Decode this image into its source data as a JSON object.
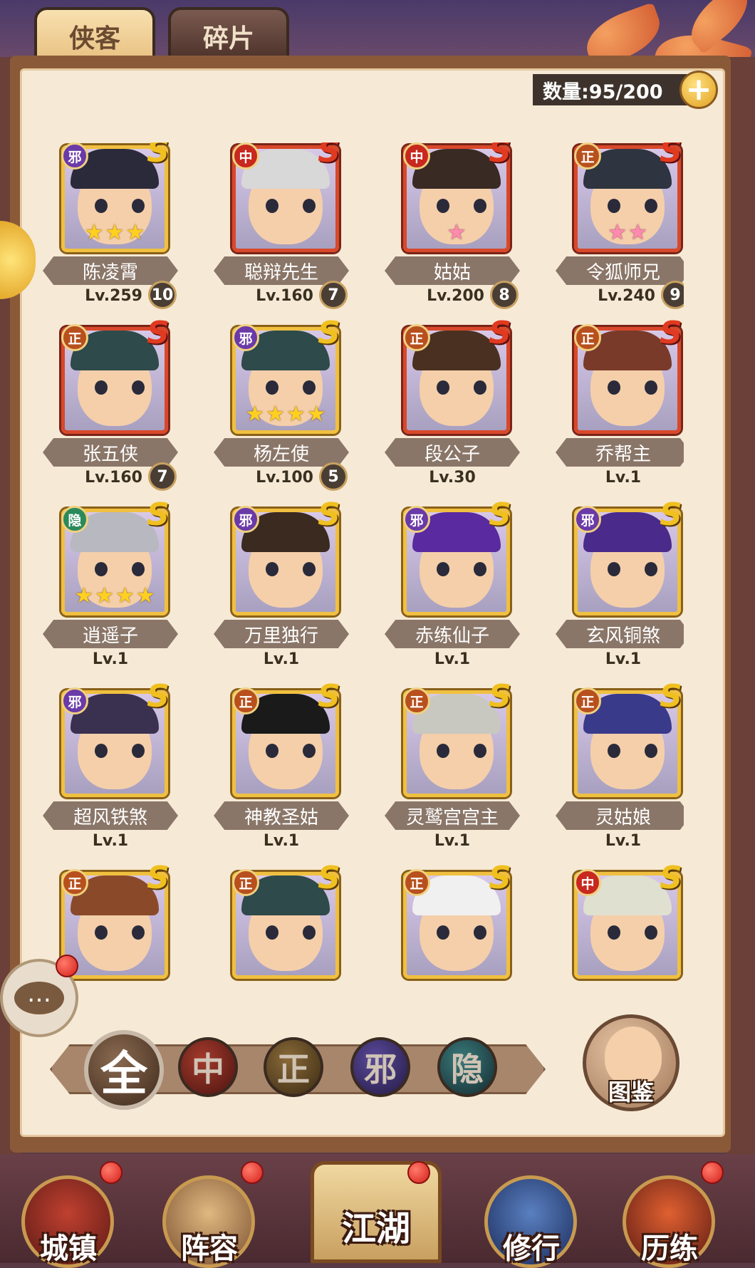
{
  "tabs": [
    {
      "label": "侠客",
      "active": true
    },
    {
      "label": "碎片",
      "active": false
    }
  ],
  "count": {
    "text": "数量:95/200",
    "add_label": "+"
  },
  "heroes": [
    {
      "name": "陈凌霄",
      "faction": "邪",
      "rank": "S",
      "rank_color": "gold",
      "stars": 3,
      "star_type": "gold",
      "level": "Lv.259",
      "copies": "10"
    },
    {
      "name": "聪辩先生",
      "faction": "中",
      "rank": "S",
      "rank_color": "red",
      "stars": 0,
      "star_type": "",
      "level": "Lv.160",
      "copies": "7"
    },
    {
      "name": "姑姑",
      "faction": "中",
      "rank": "S",
      "rank_color": "red",
      "stars": 1,
      "star_type": "pink",
      "level": "Lv.200",
      "copies": "8"
    },
    {
      "name": "令狐师兄",
      "faction": "正",
      "rank": "S",
      "rank_color": "red",
      "stars": 2,
      "star_type": "pink",
      "level": "Lv.240",
      "copies": "9"
    },
    {
      "name": "张五侠",
      "faction": "正",
      "rank": "S",
      "rank_color": "red",
      "stars": 0,
      "star_type": "",
      "level": "Lv.160",
      "copies": "7"
    },
    {
      "name": "杨左使",
      "faction": "邪",
      "rank": "S",
      "rank_color": "gold",
      "stars": 4,
      "star_type": "gold",
      "level": "Lv.100",
      "copies": "5"
    },
    {
      "name": "段公子",
      "faction": "正",
      "rank": "S",
      "rank_color": "red",
      "stars": 0,
      "star_type": "",
      "level": "Lv.30",
      "copies": ""
    },
    {
      "name": "乔帮主",
      "faction": "正",
      "rank": "S",
      "rank_color": "red",
      "stars": 0,
      "star_type": "",
      "level": "Lv.1",
      "copies": ""
    },
    {
      "name": "逍遥子",
      "faction": "隐",
      "rank": "S",
      "rank_color": "gold",
      "stars": 4,
      "star_type": "gold",
      "level": "Lv.1",
      "copies": ""
    },
    {
      "name": "万里独行",
      "faction": "邪",
      "rank": "S",
      "rank_color": "gold",
      "stars": 0,
      "star_type": "",
      "level": "Lv.1",
      "copies": ""
    },
    {
      "name": "赤练仙子",
      "faction": "邪",
      "rank": "S",
      "rank_color": "gold",
      "stars": 0,
      "star_type": "",
      "level": "Lv.1",
      "copies": ""
    },
    {
      "name": "玄风铜煞",
      "faction": "邪",
      "rank": "S",
      "rank_color": "gold",
      "stars": 0,
      "star_type": "",
      "level": "Lv.1",
      "copies": ""
    },
    {
      "name": "超风铁煞",
      "faction": "邪",
      "rank": "S",
      "rank_color": "gold",
      "stars": 0,
      "star_type": "",
      "level": "Lv.1",
      "copies": ""
    },
    {
      "name": "神教圣姑",
      "faction": "正",
      "rank": "S",
      "rank_color": "gold",
      "stars": 0,
      "star_type": "",
      "level": "Lv.1",
      "copies": ""
    },
    {
      "name": "灵鹫宫宫主",
      "faction": "正",
      "rank": "S",
      "rank_color": "gold",
      "stars": 0,
      "star_type": "",
      "level": "Lv.1",
      "copies": ""
    },
    {
      "name": "灵姑娘",
      "faction": "正",
      "rank": "S",
      "rank_color": "gold",
      "stars": 0,
      "star_type": "",
      "level": "Lv.1",
      "copies": ""
    },
    {
      "name": "",
      "faction": "正",
      "rank": "S",
      "rank_color": "gold",
      "stars": 0,
      "star_type": "",
      "level": "",
      "copies": ""
    },
    {
      "name": "",
      "faction": "正",
      "rank": "S",
      "rank_color": "gold",
      "stars": 0,
      "star_type": "",
      "level": "",
      "copies": ""
    },
    {
      "name": "",
      "faction": "正",
      "rank": "S",
      "rank_color": "gold",
      "stars": 0,
      "star_type": "",
      "level": "",
      "copies": ""
    },
    {
      "name": "",
      "faction": "中",
      "rank": "S",
      "rank_color": "gold",
      "stars": 0,
      "star_type": "",
      "level": "",
      "copies": ""
    }
  ],
  "filters": [
    {
      "label": "全",
      "key": "all",
      "active": true
    },
    {
      "label": "中",
      "key": "zhong",
      "active": false
    },
    {
      "label": "正",
      "key": "zheng",
      "active": false
    },
    {
      "label": "邪",
      "key": "xie",
      "active": false
    },
    {
      "label": "隐",
      "key": "yin",
      "active": false
    }
  ],
  "codex_label": "图鉴",
  "chat_icon": "…",
  "bottom_nav": [
    {
      "label": "城镇",
      "icon": "town-icon",
      "has_dot": true
    },
    {
      "label": "阵容",
      "icon": "lineup-icon",
      "has_dot": true
    },
    {
      "label": "江湖",
      "icon": "jianghu-scroll-icon",
      "has_dot": true
    },
    {
      "label": "修行",
      "icon": "training-icon",
      "has_dot": false
    },
    {
      "label": "历练",
      "icon": "trial-icon",
      "has_dot": true
    }
  ],
  "colors": {
    "faction_邪": "#6a3aa8",
    "faction_中": "#c8281e",
    "faction_正": "#b8501e",
    "faction_隐": "#2a8a5a",
    "paper": "#f6ead6",
    "name_plate": "#8a7668"
  }
}
